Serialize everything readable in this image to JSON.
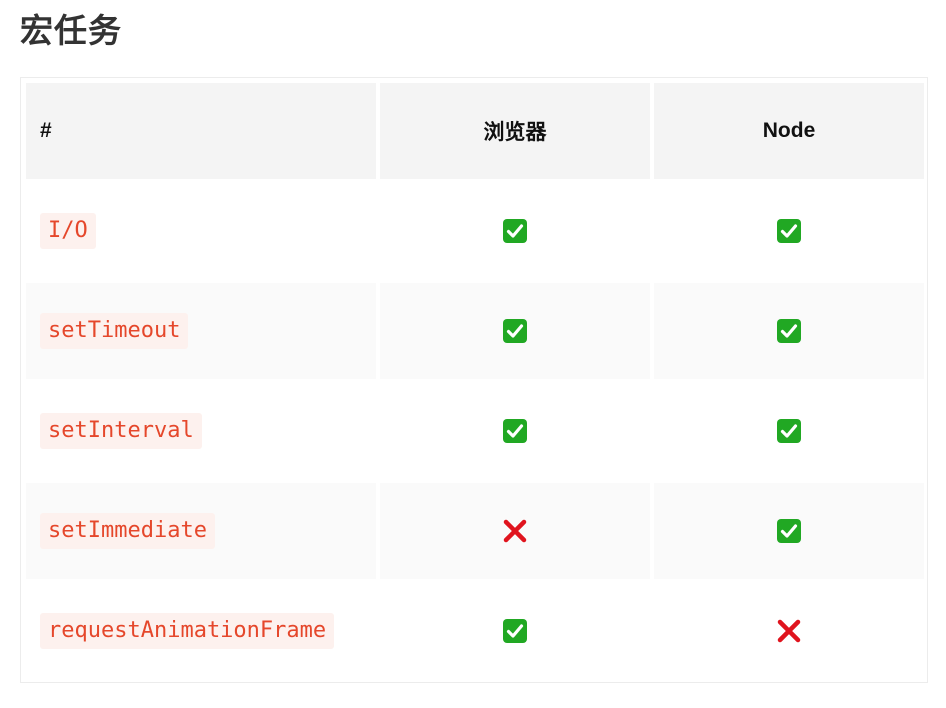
{
  "heading": "宏任务",
  "table": {
    "columns": [
      "#",
      "浏览器",
      "Node"
    ],
    "rows": [
      {
        "name": "I/O",
        "browser": "yes",
        "node": "yes"
      },
      {
        "name": "setTimeout",
        "browser": "yes",
        "node": "yes"
      },
      {
        "name": "setInterval",
        "browser": "yes",
        "node": "yes"
      },
      {
        "name": "setImmediate",
        "browser": "no",
        "node": "yes"
      },
      {
        "name": "requestAnimationFrame",
        "browser": "yes",
        "node": "no"
      }
    ]
  },
  "icons": {
    "yes": "check-mark-icon",
    "no": "cross-mark-icon"
  },
  "colors": {
    "code_text": "#e5472b",
    "check_fill": "#21a823",
    "cross": "#e0141e",
    "header_bg": "#f4f4f4"
  }
}
